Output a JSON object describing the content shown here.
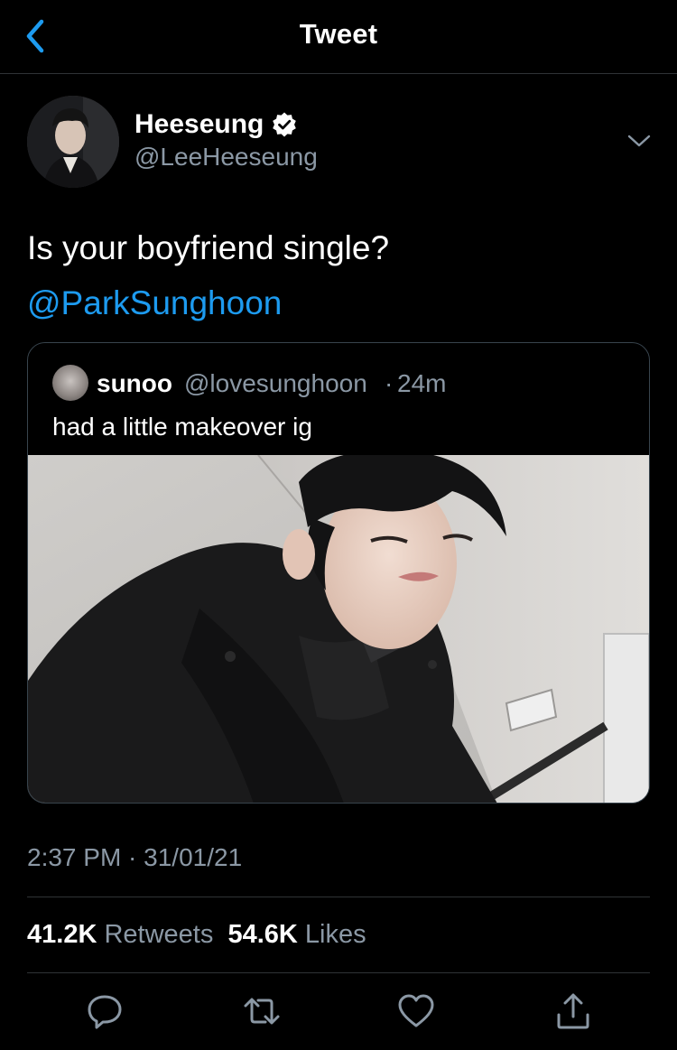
{
  "header": {
    "title": "Tweet"
  },
  "tweet": {
    "author": {
      "display_name": "Heeseung",
      "handle": "@LeeHeeseung",
      "verified": true
    },
    "text": "Is your boyfriend single?",
    "mention": "@ParkSunghoon",
    "quoted": {
      "author_name": "sunoo",
      "author_handle": "@lovesunghoon",
      "separator": "·",
      "time_ago": "24m",
      "text": "had a little makeover ig"
    },
    "timestamp": "2:37 PM · 31/01/21",
    "stats": {
      "retweets_count": "41.2K",
      "retweets_label": "Retweets",
      "likes_count": "54.6K",
      "likes_label": "Likes"
    }
  },
  "icons": {
    "back": "chevron-left-icon",
    "verified": "verified-badge-icon",
    "more": "chevron-down-icon",
    "reply": "reply-icon",
    "retweet": "retweet-icon",
    "like": "heart-icon",
    "share": "share-icon"
  },
  "colors": {
    "background": "#000000",
    "accent": "#1d9bf0",
    "secondary_text": "#8b98a5",
    "divider": "#2f3336"
  }
}
